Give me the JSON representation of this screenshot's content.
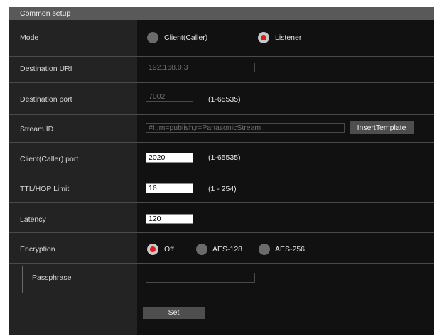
{
  "header": {
    "title": "Common setup"
  },
  "rows": {
    "mode": {
      "label": "Mode",
      "options": [
        "Client(Caller)",
        "Listener"
      ],
      "selected": "Listener"
    },
    "destination_uri": {
      "label": "Destination URI",
      "value": "192.168.0.3"
    },
    "destination_port": {
      "label": "Destination port",
      "value": "7002",
      "range": "(1-65535)"
    },
    "stream_id": {
      "label": "Stream ID",
      "value": "#!::m=publish,r=PanasonicStream",
      "button": "InsertTemplate"
    },
    "client_port": {
      "label": "Client(Caller) port",
      "value": "2020",
      "range": "(1-65535)"
    },
    "ttl": {
      "label": "TTL/HOP Limit",
      "value": "16",
      "range": "(1 - 254)"
    },
    "latency": {
      "label": "Latency",
      "value": "120"
    },
    "encryption": {
      "label": "Encryption",
      "options": [
        "Off",
        "AES-128",
        "AES-256"
      ],
      "selected": "Off"
    },
    "passphrase": {
      "label": "Passphrase",
      "value": ""
    }
  },
  "actions": {
    "set_label": "Set"
  },
  "colors": {
    "background": "#111111",
    "label_column": "#232323",
    "header": "#595959",
    "radio_selected": "#e11a1a"
  }
}
